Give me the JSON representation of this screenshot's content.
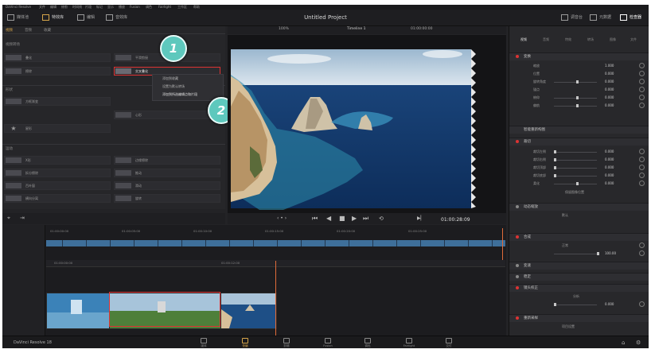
{
  "window": {
    "title": "Untitled Project",
    "menus": [
      "DaVinci Resolve",
      "文件",
      "编辑",
      "修剪",
      "时间线",
      "片段",
      "标记",
      "显示",
      "播放",
      "Fusion",
      "调色",
      "Fairlight",
      "工作区",
      "帮助"
    ]
  },
  "toolbar": {
    "media_pool": "媒体池",
    "effects_library": "特效库",
    "edit_index": "编辑",
    "sound_library": "音效库",
    "mixer": "调音台",
    "metadata": "元数据",
    "inspector": "检查器"
  },
  "effects": {
    "tabs": [
      "视频",
      "音频",
      "收藏"
    ],
    "sec_transition": "视频转场",
    "sec_shape": "形状",
    "sec_motion": "运动",
    "items_left": [
      "叠化",
      "擦除",
      "交叉叠化"
    ],
    "items_right": [
      "交叉叠化",
      "平滑剪接"
    ],
    "shape_items": [
      "方框渐变",
      "心形",
      "星形"
    ],
    "motion_items": [
      "X形",
      "拆分擦除",
      "百叶窗",
      "横向分离"
    ],
    "motion_items_right": [
      "边缘擦除",
      "推动",
      "滑动",
      "旋转"
    ],
    "context_menu": [
      "添加到收藏",
      "设置为默认转场",
      "添加到所选编辑点和片段"
    ]
  },
  "badges": {
    "one": "1",
    "two": "2"
  },
  "viewer": {
    "timeline_name": "Timeline 1",
    "timecode_top": "01:00:00:00",
    "zoom": "100%",
    "timecode": "01:00:28:09"
  },
  "inspector": {
    "tabs": [
      "视频",
      "音频",
      "特效",
      "转场",
      "图像",
      "文件"
    ],
    "sections": [
      "变换",
      "智能重新构图",
      "裁切",
      "动态缩放",
      "合成",
      "变速",
      "稳定",
      "镜头校正",
      "重新采样"
    ],
    "rows": [
      {
        "k": "缩放",
        "v": "1.000"
      },
      {
        "k": "位置",
        "v": "0.000"
      },
      {
        "k": "旋转角度",
        "v": "0.000"
      },
      {
        "k": "锚点",
        "v": "0.000"
      },
      {
        "k": "俯仰",
        "v": "0.000"
      },
      {
        "k": "偏航",
        "v": "0.000"
      }
    ],
    "crop_rows": [
      {
        "k": "裁切左侧",
        "v": "0.000"
      },
      {
        "k": "裁切右侧",
        "v": "0.000"
      },
      {
        "k": "裁切顶部",
        "v": "0.000"
      },
      {
        "k": "裁切底部",
        "v": "0.000"
      },
      {
        "k": "柔化",
        "v": "0.000"
      }
    ],
    "dz_mode": "默认",
    "composite_mode": "正常",
    "opacity": "100.00",
    "lens_analyze": "分析",
    "lens_distortion": "0.000",
    "resample_value": "项目设置",
    "retain_image": "保留图像位置"
  },
  "timeline": {
    "mini_tc": [
      "01:00:00:00",
      "01:00:05:00",
      "01:00:10:00",
      "01:00:15:00",
      "01:00:20:00",
      "01:00:25:00"
    ],
    "main_tc": [
      "01:00:00:00",
      "01:00:12:00"
    ]
  },
  "pages": [
    "媒体",
    "快编",
    "剪辑",
    "Fusion",
    "调色",
    "Fairlight",
    "交付"
  ],
  "brand": "DaVinci Resolve 18"
}
